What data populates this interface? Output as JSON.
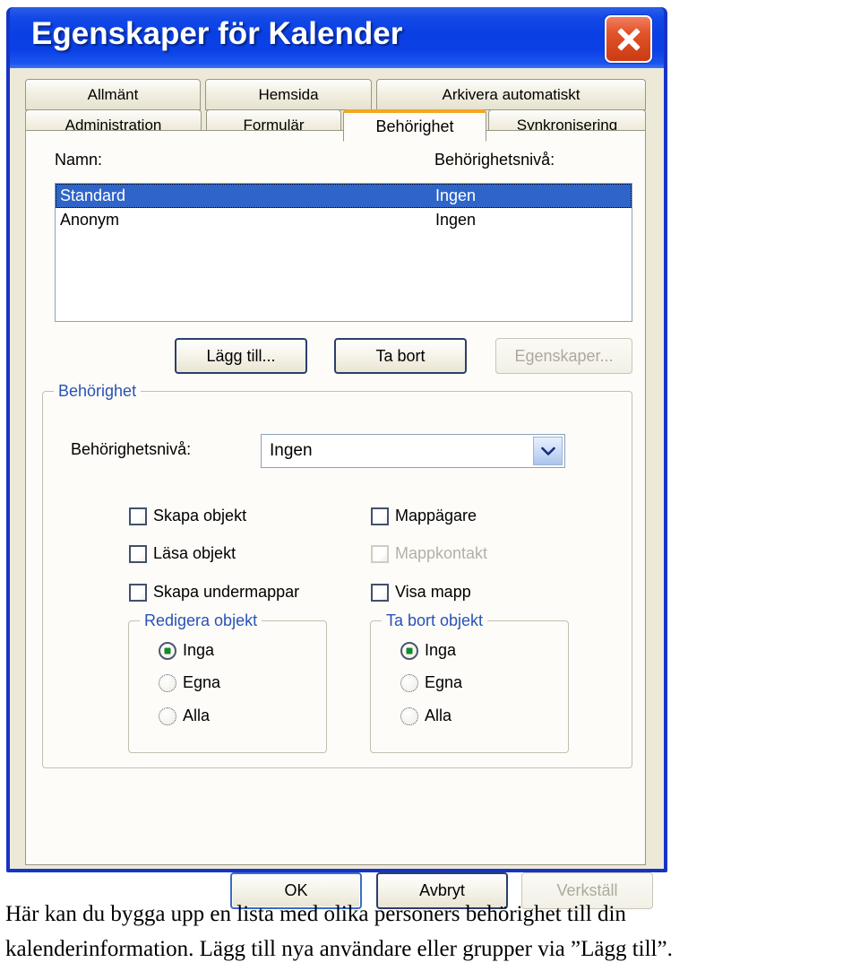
{
  "window": {
    "title": "Egenskaper för Kalender",
    "close_icon": "close-icon"
  },
  "tabs": {
    "row1": [
      {
        "label": "Allmänt",
        "selected": false
      },
      {
        "label": "Hemsida",
        "selected": false
      },
      {
        "label": "Arkivera automatiskt",
        "selected": false
      }
    ],
    "row2": [
      {
        "label": "Administration",
        "selected": false
      },
      {
        "label": "Formulär",
        "selected": false
      },
      {
        "label": "Behörighet",
        "selected": true
      },
      {
        "label": "Synkronisering",
        "selected": false
      }
    ]
  },
  "permissions_tab": {
    "name_column_label": "Namn:",
    "level_column_label": "Behörighetsnivå:",
    "list_rows": [
      {
        "name": "Standard",
        "level": "Ingen",
        "selected": true
      },
      {
        "name": "Anonym",
        "level": "Ingen",
        "selected": false
      }
    ],
    "list_buttons": {
      "add": "Lägg till...",
      "remove": "Ta bort",
      "properties": "Egenskaper..."
    },
    "permission_group": {
      "title": "Behörighet",
      "level_label": "Behörighetsnivå:",
      "level_value": "Ingen",
      "level_options": [
        "Ingen"
      ],
      "dropdown_icon": "chevron-down-icon",
      "checkboxes_left": [
        {
          "label": "Skapa objekt",
          "checked": false,
          "disabled": false
        },
        {
          "label": "Läsa objekt",
          "checked": false,
          "disabled": false
        },
        {
          "label": "Skapa undermappar",
          "checked": false,
          "disabled": false
        }
      ],
      "checkboxes_right": [
        {
          "label": "Mappägare",
          "checked": false,
          "disabled": false
        },
        {
          "label": "Mappkontakt",
          "checked": false,
          "disabled": true
        },
        {
          "label": "Visa mapp",
          "checked": false,
          "disabled": false
        }
      ],
      "edit_group": {
        "title": "Redigera objekt",
        "options": [
          {
            "label": "Inga",
            "checked": true
          },
          {
            "label": "Egna",
            "checked": false
          },
          {
            "label": "Alla",
            "checked": false
          }
        ]
      },
      "delete_group": {
        "title": "Ta bort objekt",
        "options": [
          {
            "label": "Inga",
            "checked": true
          },
          {
            "label": "Egna",
            "checked": false
          },
          {
            "label": "Alla",
            "checked": false
          }
        ]
      }
    }
  },
  "footer": {
    "ok": "OK",
    "cancel": "Avbryt",
    "apply": "Verkställ",
    "apply_disabled": true
  },
  "caption": {
    "line1": "Här kan du bygga upp en lista med olika personers behörighet till din",
    "line2": "kalenderinformation. Lägg till nya användare eller grupper via ”Lägg till”."
  },
  "colors": {
    "titlebar_blue": "#0a3fe4",
    "window_border": "#1633c8",
    "dialog_bg": "#ece9d8",
    "panel_bg": "#fdfcf8",
    "selection_blue": "#2f64c8",
    "group_title_blue": "#2951b8",
    "selected_tab_accent": "#f5a623",
    "close_red": "#cb3b11",
    "radio_dot_green": "#128a2a",
    "disabled_gray": "#b3b1a6"
  }
}
